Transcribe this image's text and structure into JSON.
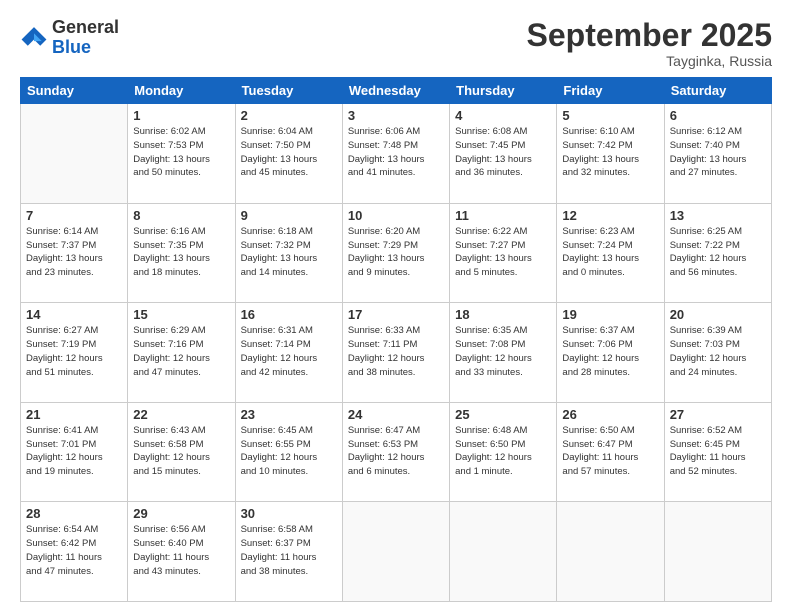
{
  "header": {
    "logo_general": "General",
    "logo_blue": "Blue",
    "month_title": "September 2025",
    "location": "Tayginka, Russia"
  },
  "days_of_week": [
    "Sunday",
    "Monday",
    "Tuesday",
    "Wednesday",
    "Thursday",
    "Friday",
    "Saturday"
  ],
  "weeks": [
    [
      {
        "day": "",
        "info": ""
      },
      {
        "day": "1",
        "info": "Sunrise: 6:02 AM\nSunset: 7:53 PM\nDaylight: 13 hours\nand 50 minutes."
      },
      {
        "day": "2",
        "info": "Sunrise: 6:04 AM\nSunset: 7:50 PM\nDaylight: 13 hours\nand 45 minutes."
      },
      {
        "day": "3",
        "info": "Sunrise: 6:06 AM\nSunset: 7:48 PM\nDaylight: 13 hours\nand 41 minutes."
      },
      {
        "day": "4",
        "info": "Sunrise: 6:08 AM\nSunset: 7:45 PM\nDaylight: 13 hours\nand 36 minutes."
      },
      {
        "day": "5",
        "info": "Sunrise: 6:10 AM\nSunset: 7:42 PM\nDaylight: 13 hours\nand 32 minutes."
      },
      {
        "day": "6",
        "info": "Sunrise: 6:12 AM\nSunset: 7:40 PM\nDaylight: 13 hours\nand 27 minutes."
      }
    ],
    [
      {
        "day": "7",
        "info": "Sunrise: 6:14 AM\nSunset: 7:37 PM\nDaylight: 13 hours\nand 23 minutes."
      },
      {
        "day": "8",
        "info": "Sunrise: 6:16 AM\nSunset: 7:35 PM\nDaylight: 13 hours\nand 18 minutes."
      },
      {
        "day": "9",
        "info": "Sunrise: 6:18 AM\nSunset: 7:32 PM\nDaylight: 13 hours\nand 14 minutes."
      },
      {
        "day": "10",
        "info": "Sunrise: 6:20 AM\nSunset: 7:29 PM\nDaylight: 13 hours\nand 9 minutes."
      },
      {
        "day": "11",
        "info": "Sunrise: 6:22 AM\nSunset: 7:27 PM\nDaylight: 13 hours\nand 5 minutes."
      },
      {
        "day": "12",
        "info": "Sunrise: 6:23 AM\nSunset: 7:24 PM\nDaylight: 13 hours\nand 0 minutes."
      },
      {
        "day": "13",
        "info": "Sunrise: 6:25 AM\nSunset: 7:22 PM\nDaylight: 12 hours\nand 56 minutes."
      }
    ],
    [
      {
        "day": "14",
        "info": "Sunrise: 6:27 AM\nSunset: 7:19 PM\nDaylight: 12 hours\nand 51 minutes."
      },
      {
        "day": "15",
        "info": "Sunrise: 6:29 AM\nSunset: 7:16 PM\nDaylight: 12 hours\nand 47 minutes."
      },
      {
        "day": "16",
        "info": "Sunrise: 6:31 AM\nSunset: 7:14 PM\nDaylight: 12 hours\nand 42 minutes."
      },
      {
        "day": "17",
        "info": "Sunrise: 6:33 AM\nSunset: 7:11 PM\nDaylight: 12 hours\nand 38 minutes."
      },
      {
        "day": "18",
        "info": "Sunrise: 6:35 AM\nSunset: 7:08 PM\nDaylight: 12 hours\nand 33 minutes."
      },
      {
        "day": "19",
        "info": "Sunrise: 6:37 AM\nSunset: 7:06 PM\nDaylight: 12 hours\nand 28 minutes."
      },
      {
        "day": "20",
        "info": "Sunrise: 6:39 AM\nSunset: 7:03 PM\nDaylight: 12 hours\nand 24 minutes."
      }
    ],
    [
      {
        "day": "21",
        "info": "Sunrise: 6:41 AM\nSunset: 7:01 PM\nDaylight: 12 hours\nand 19 minutes."
      },
      {
        "day": "22",
        "info": "Sunrise: 6:43 AM\nSunset: 6:58 PM\nDaylight: 12 hours\nand 15 minutes."
      },
      {
        "day": "23",
        "info": "Sunrise: 6:45 AM\nSunset: 6:55 PM\nDaylight: 12 hours\nand 10 minutes."
      },
      {
        "day": "24",
        "info": "Sunrise: 6:47 AM\nSunset: 6:53 PM\nDaylight: 12 hours\nand 6 minutes."
      },
      {
        "day": "25",
        "info": "Sunrise: 6:48 AM\nSunset: 6:50 PM\nDaylight: 12 hours\nand 1 minute."
      },
      {
        "day": "26",
        "info": "Sunrise: 6:50 AM\nSunset: 6:47 PM\nDaylight: 11 hours\nand 57 minutes."
      },
      {
        "day": "27",
        "info": "Sunrise: 6:52 AM\nSunset: 6:45 PM\nDaylight: 11 hours\nand 52 minutes."
      }
    ],
    [
      {
        "day": "28",
        "info": "Sunrise: 6:54 AM\nSunset: 6:42 PM\nDaylight: 11 hours\nand 47 minutes."
      },
      {
        "day": "29",
        "info": "Sunrise: 6:56 AM\nSunset: 6:40 PM\nDaylight: 11 hours\nand 43 minutes."
      },
      {
        "day": "30",
        "info": "Sunrise: 6:58 AM\nSunset: 6:37 PM\nDaylight: 11 hours\nand 38 minutes."
      },
      {
        "day": "",
        "info": ""
      },
      {
        "day": "",
        "info": ""
      },
      {
        "day": "",
        "info": ""
      },
      {
        "day": "",
        "info": ""
      }
    ]
  ]
}
